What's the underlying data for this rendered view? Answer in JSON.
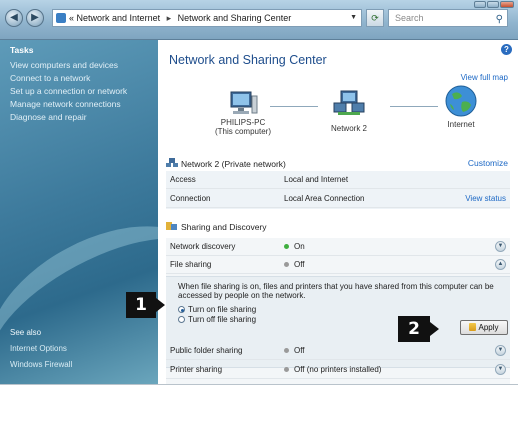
{
  "window": {
    "back_glyph": "◀",
    "forward_glyph": "▶",
    "address": {
      "icon": "network-folder-icon",
      "prefix": "«",
      "crumb1": "Network and Internet",
      "crumb2": "Network and Sharing Center"
    },
    "refresh_glyph": "⟳",
    "search_placeholder": "Search"
  },
  "sidebar": {
    "heading": "Tasks",
    "tasks": [
      "View computers and devices",
      "Connect to a network",
      "Set up a connection or network",
      "Manage network connections",
      "Diagnose and repair"
    ],
    "see_also": [
      "See also",
      "Internet Options",
      "Windows Firewall"
    ]
  },
  "main": {
    "title": "Network and Sharing Center",
    "view_full_map": "View full map",
    "map": {
      "computer": "PHILIPS-PC",
      "computer_sub": "(This computer)",
      "network": "Network 2",
      "internet": "Internet"
    },
    "network_section": {
      "name": "Network 2 (Private network)",
      "customize": "Customize",
      "rows": [
        {
          "key": "Access",
          "value": "Local and Internet",
          "action": ""
        },
        {
          "key": "Connection",
          "value": "Local Area Connection",
          "action": "View status"
        }
      ]
    },
    "sharing": {
      "heading": "Sharing and Discovery",
      "rows": [
        {
          "key": "Network discovery",
          "value": "On",
          "status_color": "#3fae3f"
        },
        {
          "key": "File sharing",
          "value": "Off",
          "status_color": "#9a9a9a"
        }
      ],
      "description": "When file sharing is on, files and printers that you have shared from this computer can be accessed by people on the network.",
      "options": [
        "Turn on file sharing",
        "Turn off file sharing"
      ],
      "selected_option": 0,
      "apply_label": "Apply",
      "rows_after": [
        {
          "key": "Public folder sharing",
          "value": "Off",
          "status_color": "#9a9a9a"
        },
        {
          "key": "Printer sharing",
          "value": "Off (no printers installed)",
          "status_color": "#9a9a9a"
        }
      ]
    }
  },
  "callouts": [
    "1",
    "2"
  ]
}
